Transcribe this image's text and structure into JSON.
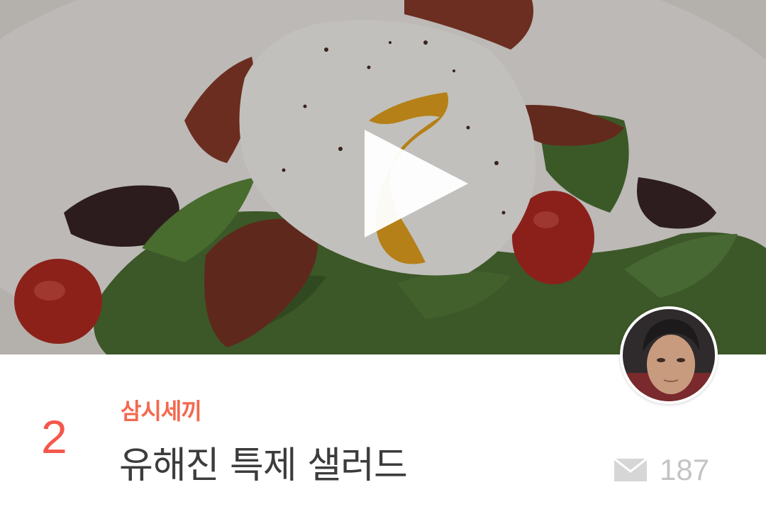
{
  "card": {
    "rank": "2",
    "category": "삼시세끼",
    "title": "유해진 특제 샐러드",
    "view_count": "187"
  },
  "icons": {
    "play": "play-icon",
    "message": "envelope-icon",
    "avatar": "user-avatar"
  },
  "colors": {
    "rank": "#f4574b",
    "category": "#f4684f",
    "title": "#3c3c3c",
    "count": "#c4c4c4",
    "overlay": "#000000"
  }
}
